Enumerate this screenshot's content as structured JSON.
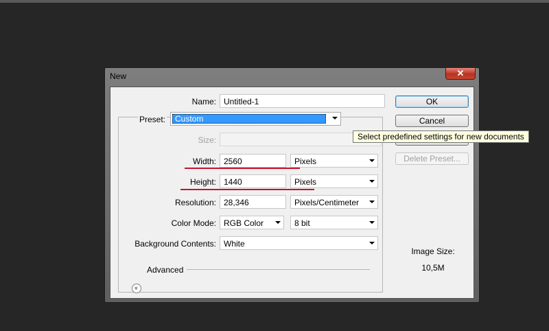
{
  "dialog": {
    "title": "New",
    "close_glyph": "✕"
  },
  "form": {
    "name": {
      "label": "Name:",
      "value": "Untitled-1"
    },
    "preset": {
      "label": "Preset:",
      "value": "Custom"
    },
    "size": {
      "label": "Size:",
      "value": ""
    },
    "width": {
      "label": "Width:",
      "value": "2560",
      "unit": "Pixels"
    },
    "height": {
      "label": "Height:",
      "value": "1440",
      "unit": "Pixels"
    },
    "resolution": {
      "label": "Resolution:",
      "value": "28,346",
      "unit": "Pixels/Centimeter"
    },
    "color_mode": {
      "label": "Color Mode:",
      "value": "RGB Color",
      "depth": "8 bit"
    },
    "background": {
      "label": "Background Contents:",
      "value": "White"
    },
    "advanced": {
      "label": "Advanced",
      "icon": "expand-chevrons-icon",
      "glyph": "»"
    }
  },
  "buttons": {
    "ok": "OK",
    "cancel": "Cancel",
    "delete_preset": "Delete Preset..."
  },
  "image_size": {
    "label": "Image Size:",
    "value": "10,5M"
  },
  "tooltip": "Select predefined settings for new documents",
  "colors": {
    "selection": "#3399ff",
    "annotation_underline": "#c8102e",
    "close_button": "#c9462e",
    "tooltip_bg": "#ffffe1"
  }
}
